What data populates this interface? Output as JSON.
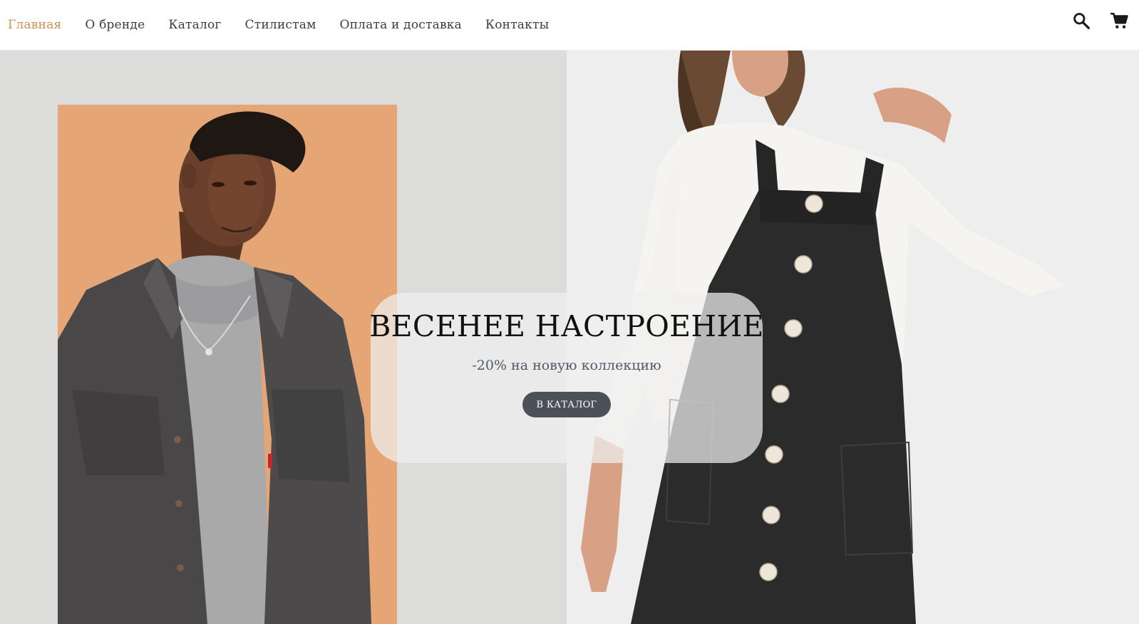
{
  "nav": {
    "items": [
      {
        "label": "Главная",
        "active": true
      },
      {
        "label": "О бренде",
        "active": false
      },
      {
        "label": "Каталог",
        "active": false
      },
      {
        "label": "Стилистам",
        "active": false
      },
      {
        "label": "Оплата и доставка",
        "active": false
      },
      {
        "label": "Контакты",
        "active": false
      }
    ]
  },
  "header_icons": [
    "search-icon",
    "cart-icon"
  ],
  "hero": {
    "title": "ВЕСЕНЕЕ НАСТРОЕНИЕ",
    "subtitle": "-20% на новую коллекцию",
    "button_label": "В КАТАЛОГ"
  },
  "colors": {
    "accent": "#d48d52",
    "button_bg": "#4c5159",
    "photo_left_bg": "#e6a574",
    "hero_left_bg": "#dcdcdb"
  }
}
